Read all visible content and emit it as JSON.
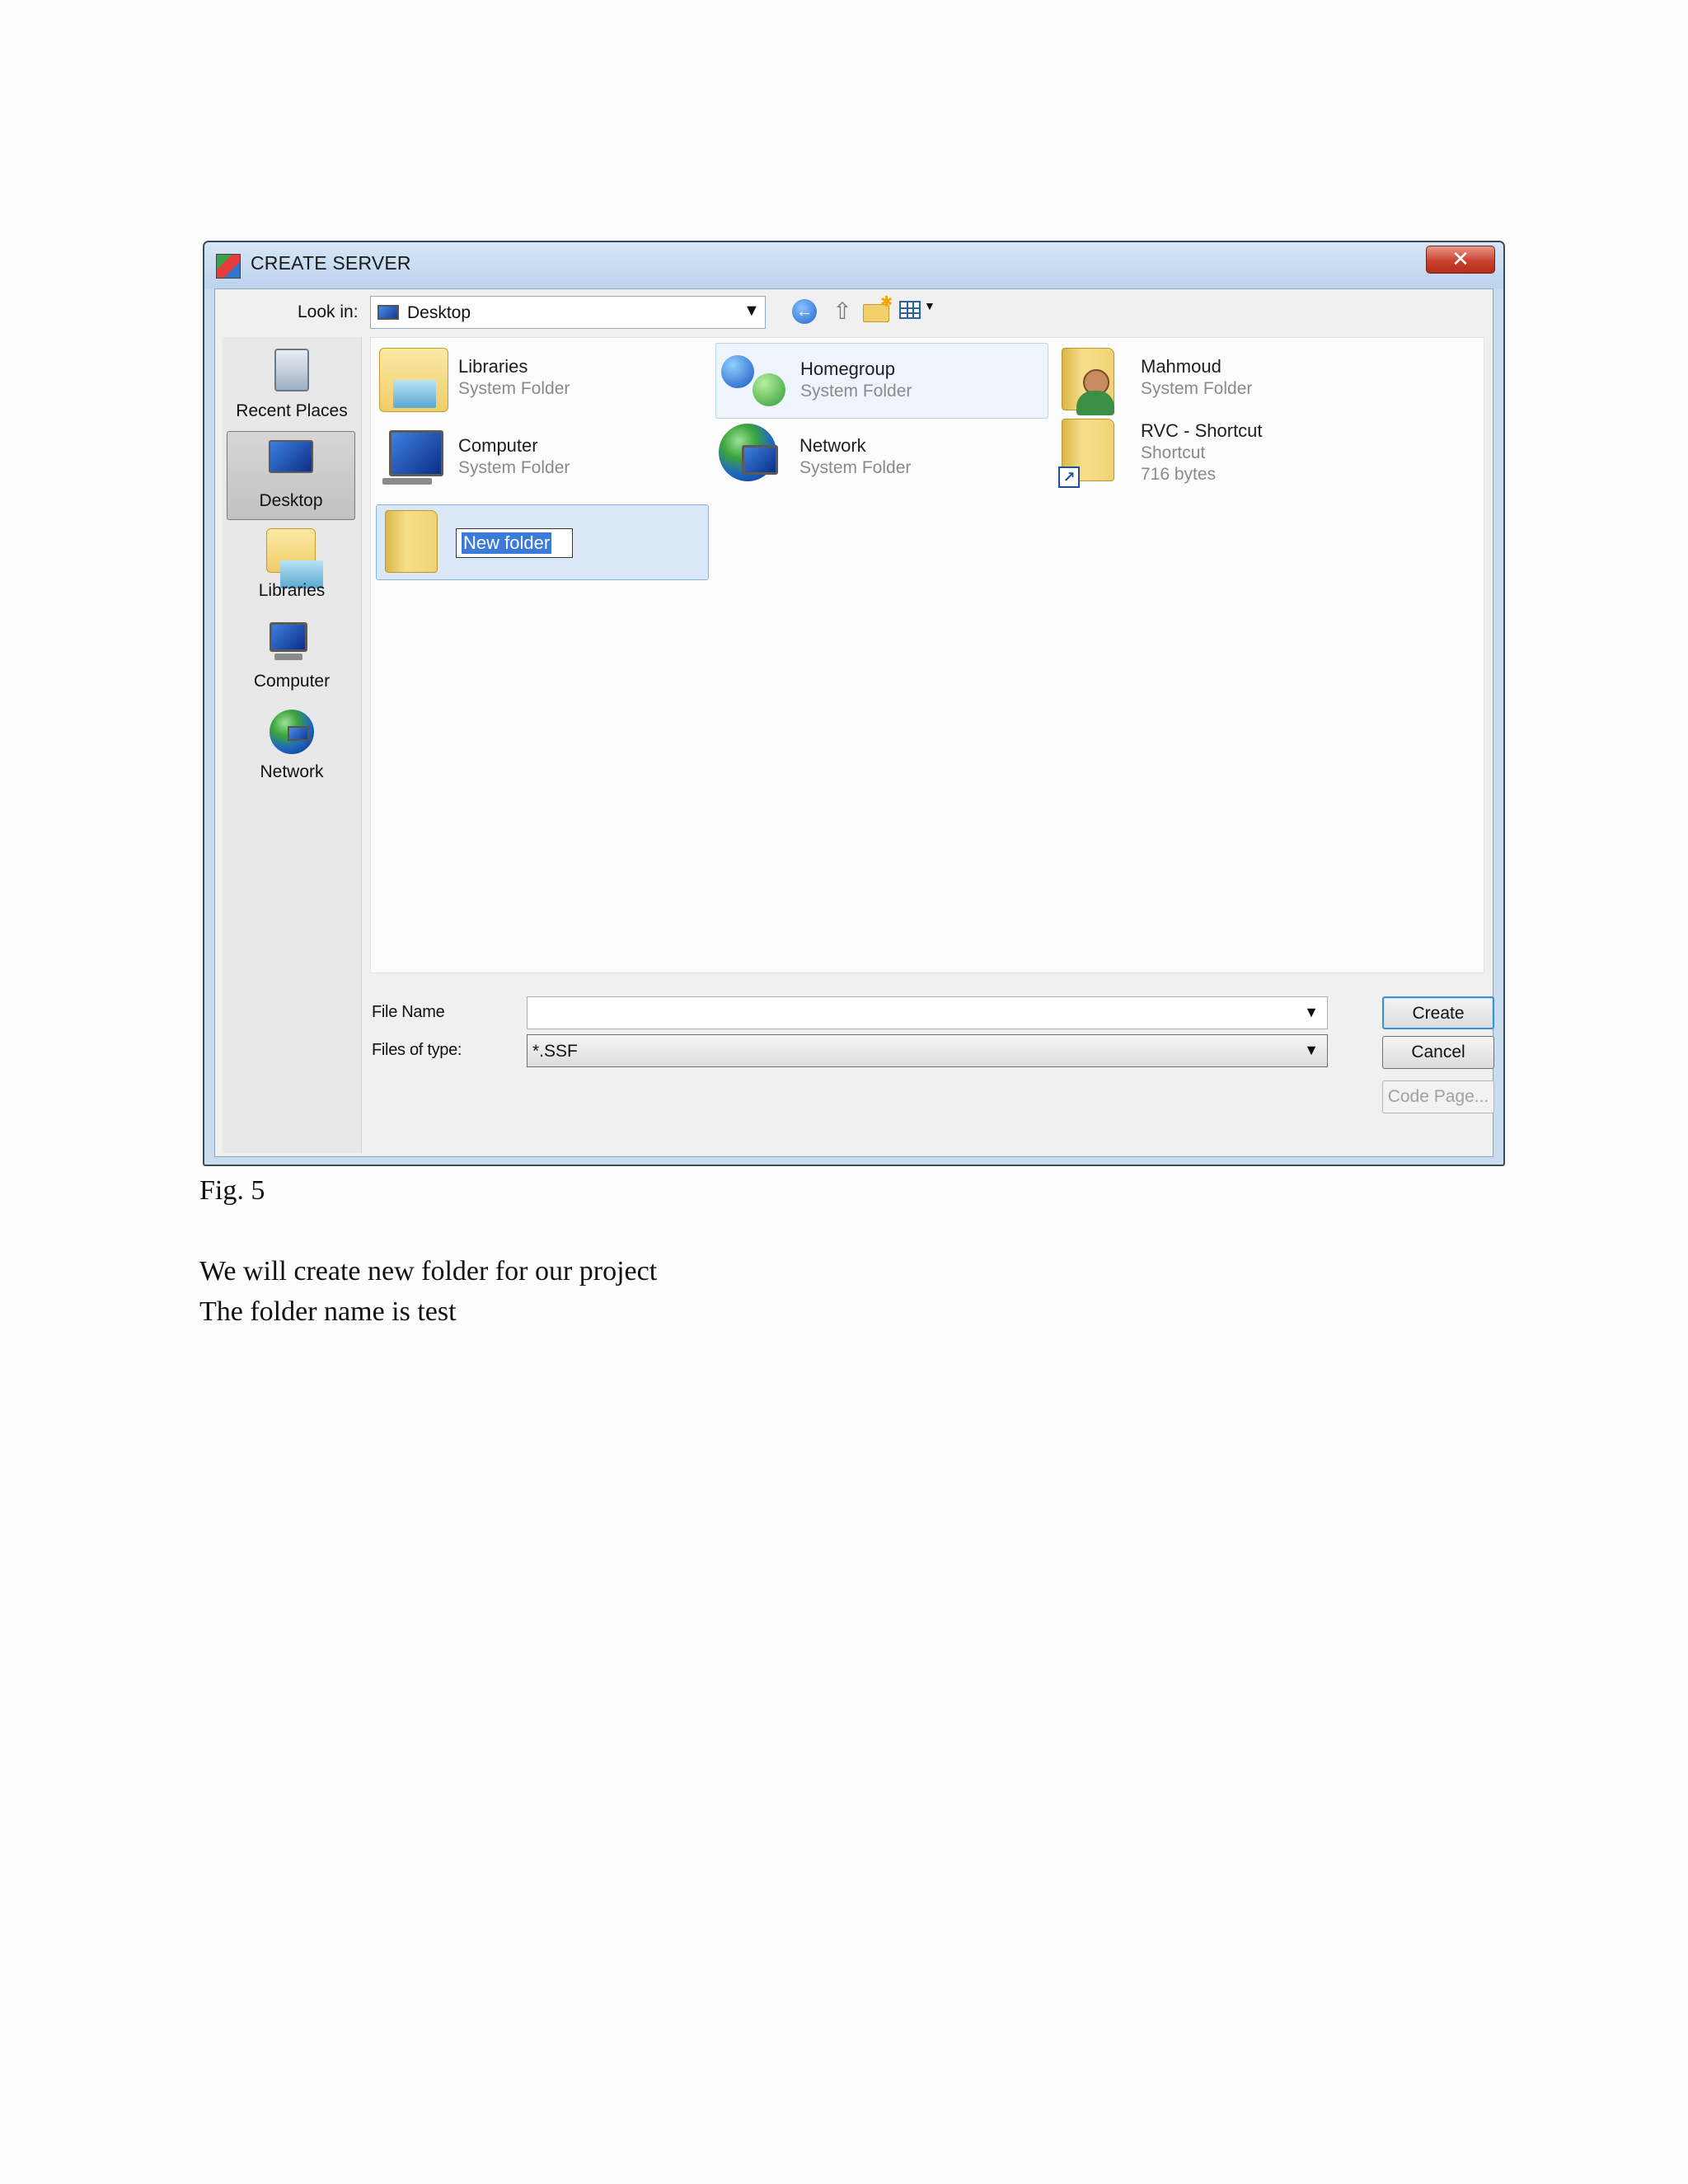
{
  "dialog": {
    "title": "CREATE SERVER",
    "close_symbol": "✕",
    "look_in_label": "Look in:",
    "look_in_value": "Desktop",
    "places": [
      {
        "label": "Recent Places",
        "icon": "recent-places-icon",
        "selected": false
      },
      {
        "label": "Desktop",
        "icon": "desktop-icon",
        "selected": true
      },
      {
        "label": "Libraries",
        "icon": "libraries-icon",
        "selected": false
      },
      {
        "label": "Computer",
        "icon": "computer-icon",
        "selected": false
      },
      {
        "label": "Network",
        "icon": "network-icon",
        "selected": false
      }
    ],
    "items": [
      {
        "name": "Libraries",
        "type": "System Folder",
        "icon": "libraries-folder-icon"
      },
      {
        "name": "Homegroup",
        "type": "System Folder",
        "icon": "homegroup-icon"
      },
      {
        "name": "Mahmoud",
        "type": "System Folder",
        "icon": "user-folder-icon"
      },
      {
        "name": "Computer",
        "type": "System Folder",
        "icon": "computer-icon"
      },
      {
        "name": "Network",
        "type": "System Folder",
        "icon": "network-icon"
      },
      {
        "name": "RVC - Shortcut",
        "type": "Shortcut",
        "size": "716 bytes",
        "icon": "shortcut-folder-icon"
      }
    ],
    "new_folder_name": "New folder",
    "file_name_label": "File Name",
    "file_name_value": "",
    "files_of_type_label": "Files of type:",
    "files_of_type_value": "*.SSF",
    "create_button": "Create",
    "cancel_button": "Cancel",
    "code_page_button": "Code Page..."
  },
  "document": {
    "figure_caption": "Fig. 5",
    "line1": "We will create new folder for our project",
    "line2": "The folder name is test"
  },
  "colors": {
    "selection": "#3b7ad9",
    "title_bar": "#bcd3ec",
    "close_button": "#c8422f"
  }
}
